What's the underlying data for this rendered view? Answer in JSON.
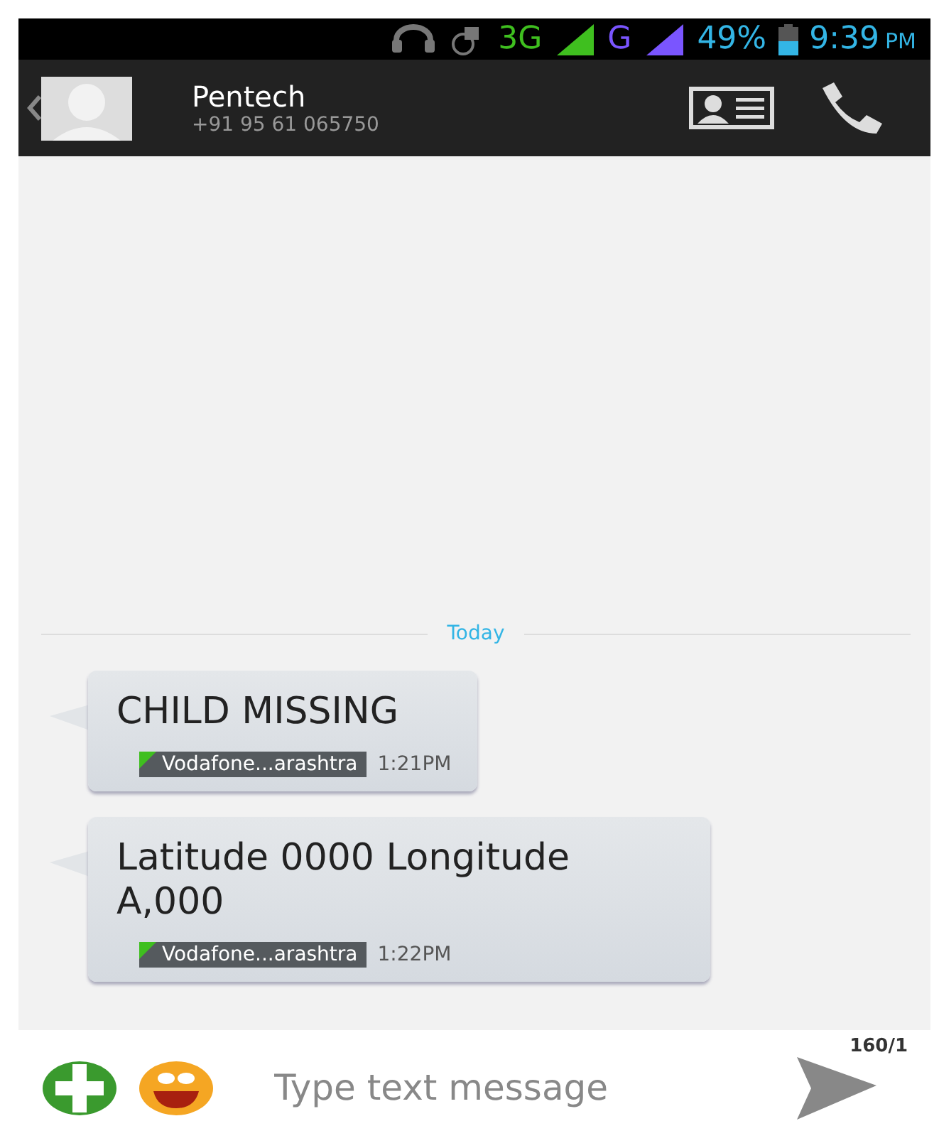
{
  "status_bar": {
    "network_3g": "3G",
    "network_g": "G",
    "battery": "49%",
    "time": "9:39",
    "am_pm": "PM"
  },
  "header": {
    "name": "Pentech",
    "number": "+91 95 61 065750"
  },
  "divider_label": "Today",
  "messages": [
    {
      "text": "CHILD MISSING",
      "sim": "Vodafone...arashtra",
      "time": "1:21PM"
    },
    {
      "text": "Latitude 0000 Longitude A,000",
      "sim": "Vodafone...arashtra",
      "time": "1:22PM"
    }
  ],
  "composer": {
    "counter": "160/1",
    "placeholder": "Type text message"
  }
}
